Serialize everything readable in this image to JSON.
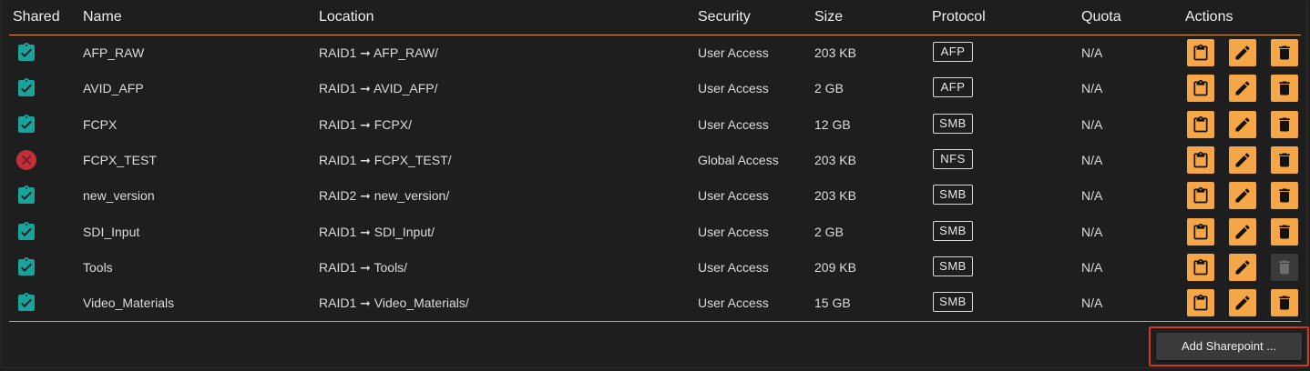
{
  "header": {
    "shared": "Shared",
    "name": "Name",
    "location": "Location",
    "security": "Security",
    "size": "Size",
    "protocol": "Protocol",
    "quota": "Quota",
    "actions": "Actions"
  },
  "rows": [
    {
      "shared": "check",
      "name": "AFP_RAW",
      "location": "RAID1 ➞ AFP_RAW/",
      "security": "User Access",
      "size": "203 KB",
      "protocol": "AFP",
      "quota": "N/A",
      "delete_enabled": true
    },
    {
      "shared": "check",
      "name": "AVID_AFP",
      "location": "RAID1 ➞ AVID_AFP/",
      "security": "User Access",
      "size": "2 GB",
      "protocol": "AFP",
      "quota": "N/A",
      "delete_enabled": true
    },
    {
      "shared": "check",
      "name": "FCPX",
      "location": "RAID1 ➞ FCPX/",
      "security": "User Access",
      "size": "12 GB",
      "protocol": "SMB",
      "quota": "N/A",
      "delete_enabled": true
    },
    {
      "shared": "error",
      "name": "FCPX_TEST",
      "location": "RAID1 ➞ FCPX_TEST/",
      "security": "Global Access",
      "size": "203 KB",
      "protocol": "NFS",
      "quota": "N/A",
      "delete_enabled": true
    },
    {
      "shared": "check",
      "name": "new_version",
      "location": "RAID2 ➞ new_version/",
      "security": "User Access",
      "size": "203 KB",
      "protocol": "SMB",
      "quota": "N/A",
      "delete_enabled": true
    },
    {
      "shared": "check",
      "name": "SDI_Input",
      "location": "RAID1 ➞ SDI_Input/",
      "security": "User Access",
      "size": "2 GB",
      "protocol": "SMB",
      "quota": "N/A",
      "delete_enabled": true
    },
    {
      "shared": "check",
      "name": "Tools",
      "location": "RAID1 ➞ Tools/",
      "security": "User Access",
      "size": "209 KB",
      "protocol": "SMB",
      "quota": "N/A",
      "delete_enabled": false
    },
    {
      "shared": "check",
      "name": "Video_Materials",
      "location": "RAID1 ➞ Video_Materials/",
      "security": "User Access",
      "size": "15 GB",
      "protocol": "SMB",
      "quota": "N/A",
      "delete_enabled": true
    }
  ],
  "icons": {
    "shared_ok": "clipboard-check-icon",
    "shared_error": "error-circle-icon",
    "copy": "clipboard-icon",
    "edit": "pencil-icon",
    "delete": "trash-icon"
  },
  "colors": {
    "accent": "#f5a646",
    "divider": "#e39a3a",
    "shared_ok": "#1aa39a",
    "shared_error": "#c0303a",
    "highlight": "#d23a14",
    "background": "#1e1e1e"
  },
  "footer": {
    "add_label": "Add Sharepoint ..."
  }
}
